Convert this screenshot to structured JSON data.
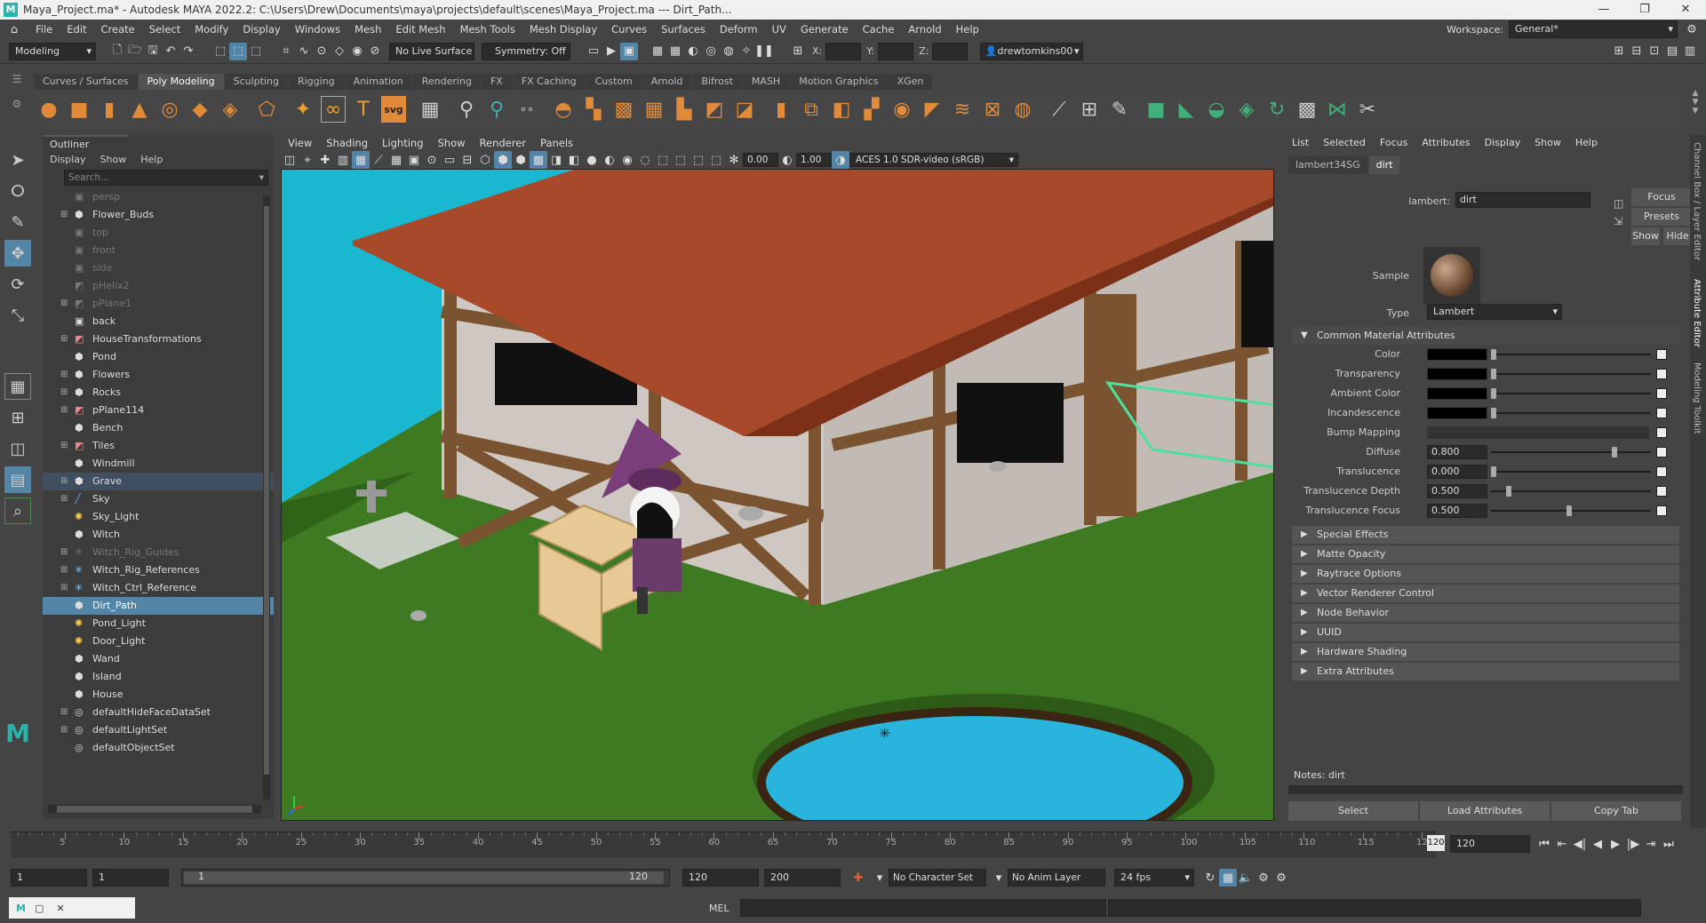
{
  "window": {
    "title": "Maya_Project.ma* - Autodesk MAYA 2022.2: C:\\Users\\Drew\\Documents\\maya\\projects\\default\\scenes\\Maya_Project.ma   ---   Dirt_Path...",
    "controls": [
      "—",
      "❐",
      "✕"
    ]
  },
  "menubar": {
    "items": [
      "File",
      "Edit",
      "Create",
      "Select",
      "Modify",
      "Display",
      "Windows",
      "Mesh",
      "Edit Mesh",
      "Mesh Tools",
      "Mesh Display",
      "Curves",
      "Surfaces",
      "Deform",
      "UV",
      "Generate",
      "Cache",
      "Arnold",
      "Help"
    ],
    "workspace_label": "Workspace:",
    "workspace_value": "General*"
  },
  "statusline": {
    "menuset": "Modeling",
    "live_surface": "No Live Surface",
    "symmetry": "Symmetry: Off",
    "x_label": "X:",
    "y_label": "Y:",
    "z_label": "Z:",
    "user": "drewtomkins00"
  },
  "shelf": {
    "tabs": [
      "Curves / Surfaces",
      "Poly Modeling",
      "Sculpting",
      "Rigging",
      "Animation",
      "Rendering",
      "FX",
      "FX Caching",
      "Custom",
      "Arnold",
      "Bifrost",
      "MASH",
      "Motion Graphics",
      "XGen"
    ],
    "active_tab": "Poly Modeling",
    "svg_label": "svg"
  },
  "outliner": {
    "title": "Outliner",
    "menu": [
      "Display",
      "Show",
      "Help"
    ],
    "search_placeholder": "Search...",
    "items": [
      {
        "label": "persp",
        "dim": true,
        "exp": false,
        "icon": "camera"
      },
      {
        "label": "Flower_Buds",
        "dim": false,
        "exp": true,
        "icon": "group"
      },
      {
        "label": "top",
        "dim": true,
        "exp": false,
        "icon": "camera"
      },
      {
        "label": "front",
        "dim": true,
        "exp": false,
        "icon": "camera"
      },
      {
        "label": "side",
        "dim": true,
        "exp": false,
        "icon": "camera"
      },
      {
        "label": "pHelix2",
        "dim": true,
        "exp": false,
        "icon": "mesh"
      },
      {
        "label": "pPlane1",
        "dim": true,
        "exp": true,
        "icon": "mesh"
      },
      {
        "label": "back",
        "dim": false,
        "exp": false,
        "icon": "camera"
      },
      {
        "label": "HouseTransformations",
        "dim": false,
        "exp": true,
        "icon": "mesh"
      },
      {
        "label": "Pond",
        "dim": false,
        "exp": false,
        "icon": "group"
      },
      {
        "label": "Flowers",
        "dim": false,
        "exp": true,
        "icon": "group"
      },
      {
        "label": "Rocks",
        "dim": false,
        "exp": true,
        "icon": "group"
      },
      {
        "label": "pPlane114",
        "dim": false,
        "exp": true,
        "icon": "mesh"
      },
      {
        "label": "Bench",
        "dim": false,
        "exp": false,
        "icon": "group"
      },
      {
        "label": "Tiles",
        "dim": false,
        "exp": true,
        "icon": "mesh"
      },
      {
        "label": "Windmill",
        "dim": false,
        "exp": false,
        "icon": "group"
      },
      {
        "label": "Grave",
        "dim": false,
        "exp": true,
        "icon": "group",
        "hilite": true
      },
      {
        "label": "Sky",
        "dim": false,
        "exp": true,
        "icon": "curve"
      },
      {
        "label": "Sky_Light",
        "dim": false,
        "exp": false,
        "icon": "light"
      },
      {
        "label": "Witch",
        "dim": false,
        "exp": false,
        "icon": "group"
      },
      {
        "label": "Witch_Rig_Guides",
        "dim": true,
        "exp": true,
        "icon": "joint"
      },
      {
        "label": "Witch_Rig_References",
        "dim": false,
        "exp": true,
        "icon": "joint"
      },
      {
        "label": "Witch_Ctrl_Reference",
        "dim": false,
        "exp": true,
        "icon": "joint"
      },
      {
        "label": "Dirt_Path",
        "dim": false,
        "exp": false,
        "icon": "group",
        "selected": true
      },
      {
        "label": "Pond_Light",
        "dim": false,
        "exp": false,
        "icon": "light"
      },
      {
        "label": "Door_Light",
        "dim": false,
        "exp": false,
        "icon": "light"
      },
      {
        "label": "Wand",
        "dim": false,
        "exp": false,
        "icon": "group"
      },
      {
        "label": "Island",
        "dim": false,
        "exp": false,
        "icon": "group"
      },
      {
        "label": "House",
        "dim": false,
        "exp": false,
        "icon": "group"
      },
      {
        "label": "defaultHideFaceDataSet",
        "dim": false,
        "exp": true,
        "icon": "set"
      },
      {
        "label": "defaultLightSet",
        "dim": false,
        "exp": true,
        "icon": "set"
      },
      {
        "label": "defaultObjectSet",
        "dim": false,
        "exp": false,
        "icon": "set"
      }
    ]
  },
  "viewport": {
    "menu": [
      "View",
      "Shading",
      "Lighting",
      "Show",
      "Renderer",
      "Panels"
    ],
    "exposure": "0.00",
    "gamma": "1.00",
    "color_space": "ACES 1.0 SDR-video (sRGB)"
  },
  "attribute_editor": {
    "menu": [
      "List",
      "Selected",
      "Focus",
      "Attributes",
      "Display",
      "Show",
      "Help"
    ],
    "tabs": [
      "lambert34SG",
      "dirt"
    ],
    "active_tab": "dirt",
    "node_type_label": "lambert:",
    "node_name": "dirt",
    "focus_label": "Focus",
    "presets_label": "Presets",
    "show_label": "Show",
    "hide_label": "Hide",
    "sample_label": "Sample",
    "type_label": "Type",
    "type_value": "Lambert",
    "common_section": "Common Material Attributes",
    "attributes": [
      {
        "label": "Color",
        "kind": "color",
        "value": "",
        "slider": 0.0
      },
      {
        "label": "Transparency",
        "kind": "color",
        "value": "",
        "slider": 0.0
      },
      {
        "label": "Ambient Color",
        "kind": "color",
        "value": "",
        "slider": 0.0
      },
      {
        "label": "Incandescence",
        "kind": "color",
        "value": "",
        "slider": 0.0
      },
      {
        "label": "Bump Mapping",
        "kind": "map",
        "value": "",
        "slider": -1
      },
      {
        "label": "Diffuse",
        "kind": "value",
        "value": "0.800",
        "slider": 0.8
      },
      {
        "label": "Translucence",
        "kind": "value",
        "value": "0.000",
        "slider": 0.0
      },
      {
        "label": "Translucence Depth",
        "kind": "value",
        "value": "0.500",
        "slider": 0.1
      },
      {
        "label": "Translucence Focus",
        "kind": "value",
        "value": "0.500",
        "slider": 0.5
      }
    ],
    "sections": [
      "Special Effects",
      "Matte Opacity",
      "Raytrace Options",
      "Vector Renderer Control",
      "Node Behavior",
      "UUID",
      "Hardware Shading",
      "Extra Attributes"
    ],
    "notes_label": "Notes:",
    "notes_value": "dirt",
    "buttons": [
      "Select",
      "Load Attributes",
      "Copy Tab"
    ]
  },
  "side_tabs": [
    "Channel Box / Layer Editor",
    "Attribute Editor",
    "Modeling Toolkit"
  ],
  "timeline": {
    "ticks": [
      "5",
      "10",
      "15",
      "20",
      "25",
      "30",
      "35",
      "40",
      "45",
      "50",
      "55",
      "60",
      "65",
      "70",
      "75",
      "80",
      "85",
      "90",
      "95",
      "100",
      "105",
      "110",
      "115",
      "120"
    ],
    "current_frame_marker": "120",
    "current_frame": "120"
  },
  "range": {
    "start": "1",
    "playback_start": "1",
    "slider_start": "1",
    "slider_end": "120",
    "playback_end": "120",
    "end": "200",
    "character_set": "No Character Set",
    "anim_layer": "No Anim Layer",
    "fps": "24 fps"
  },
  "cmdline": {
    "lang": "MEL"
  },
  "colors": {
    "accent": "#5285a6",
    "sky": "#1ab8d0",
    "grass": "#3d7a22",
    "roof": "#a84a2a",
    "wall": "#cfc7c2",
    "pond": "#28b4dc"
  }
}
